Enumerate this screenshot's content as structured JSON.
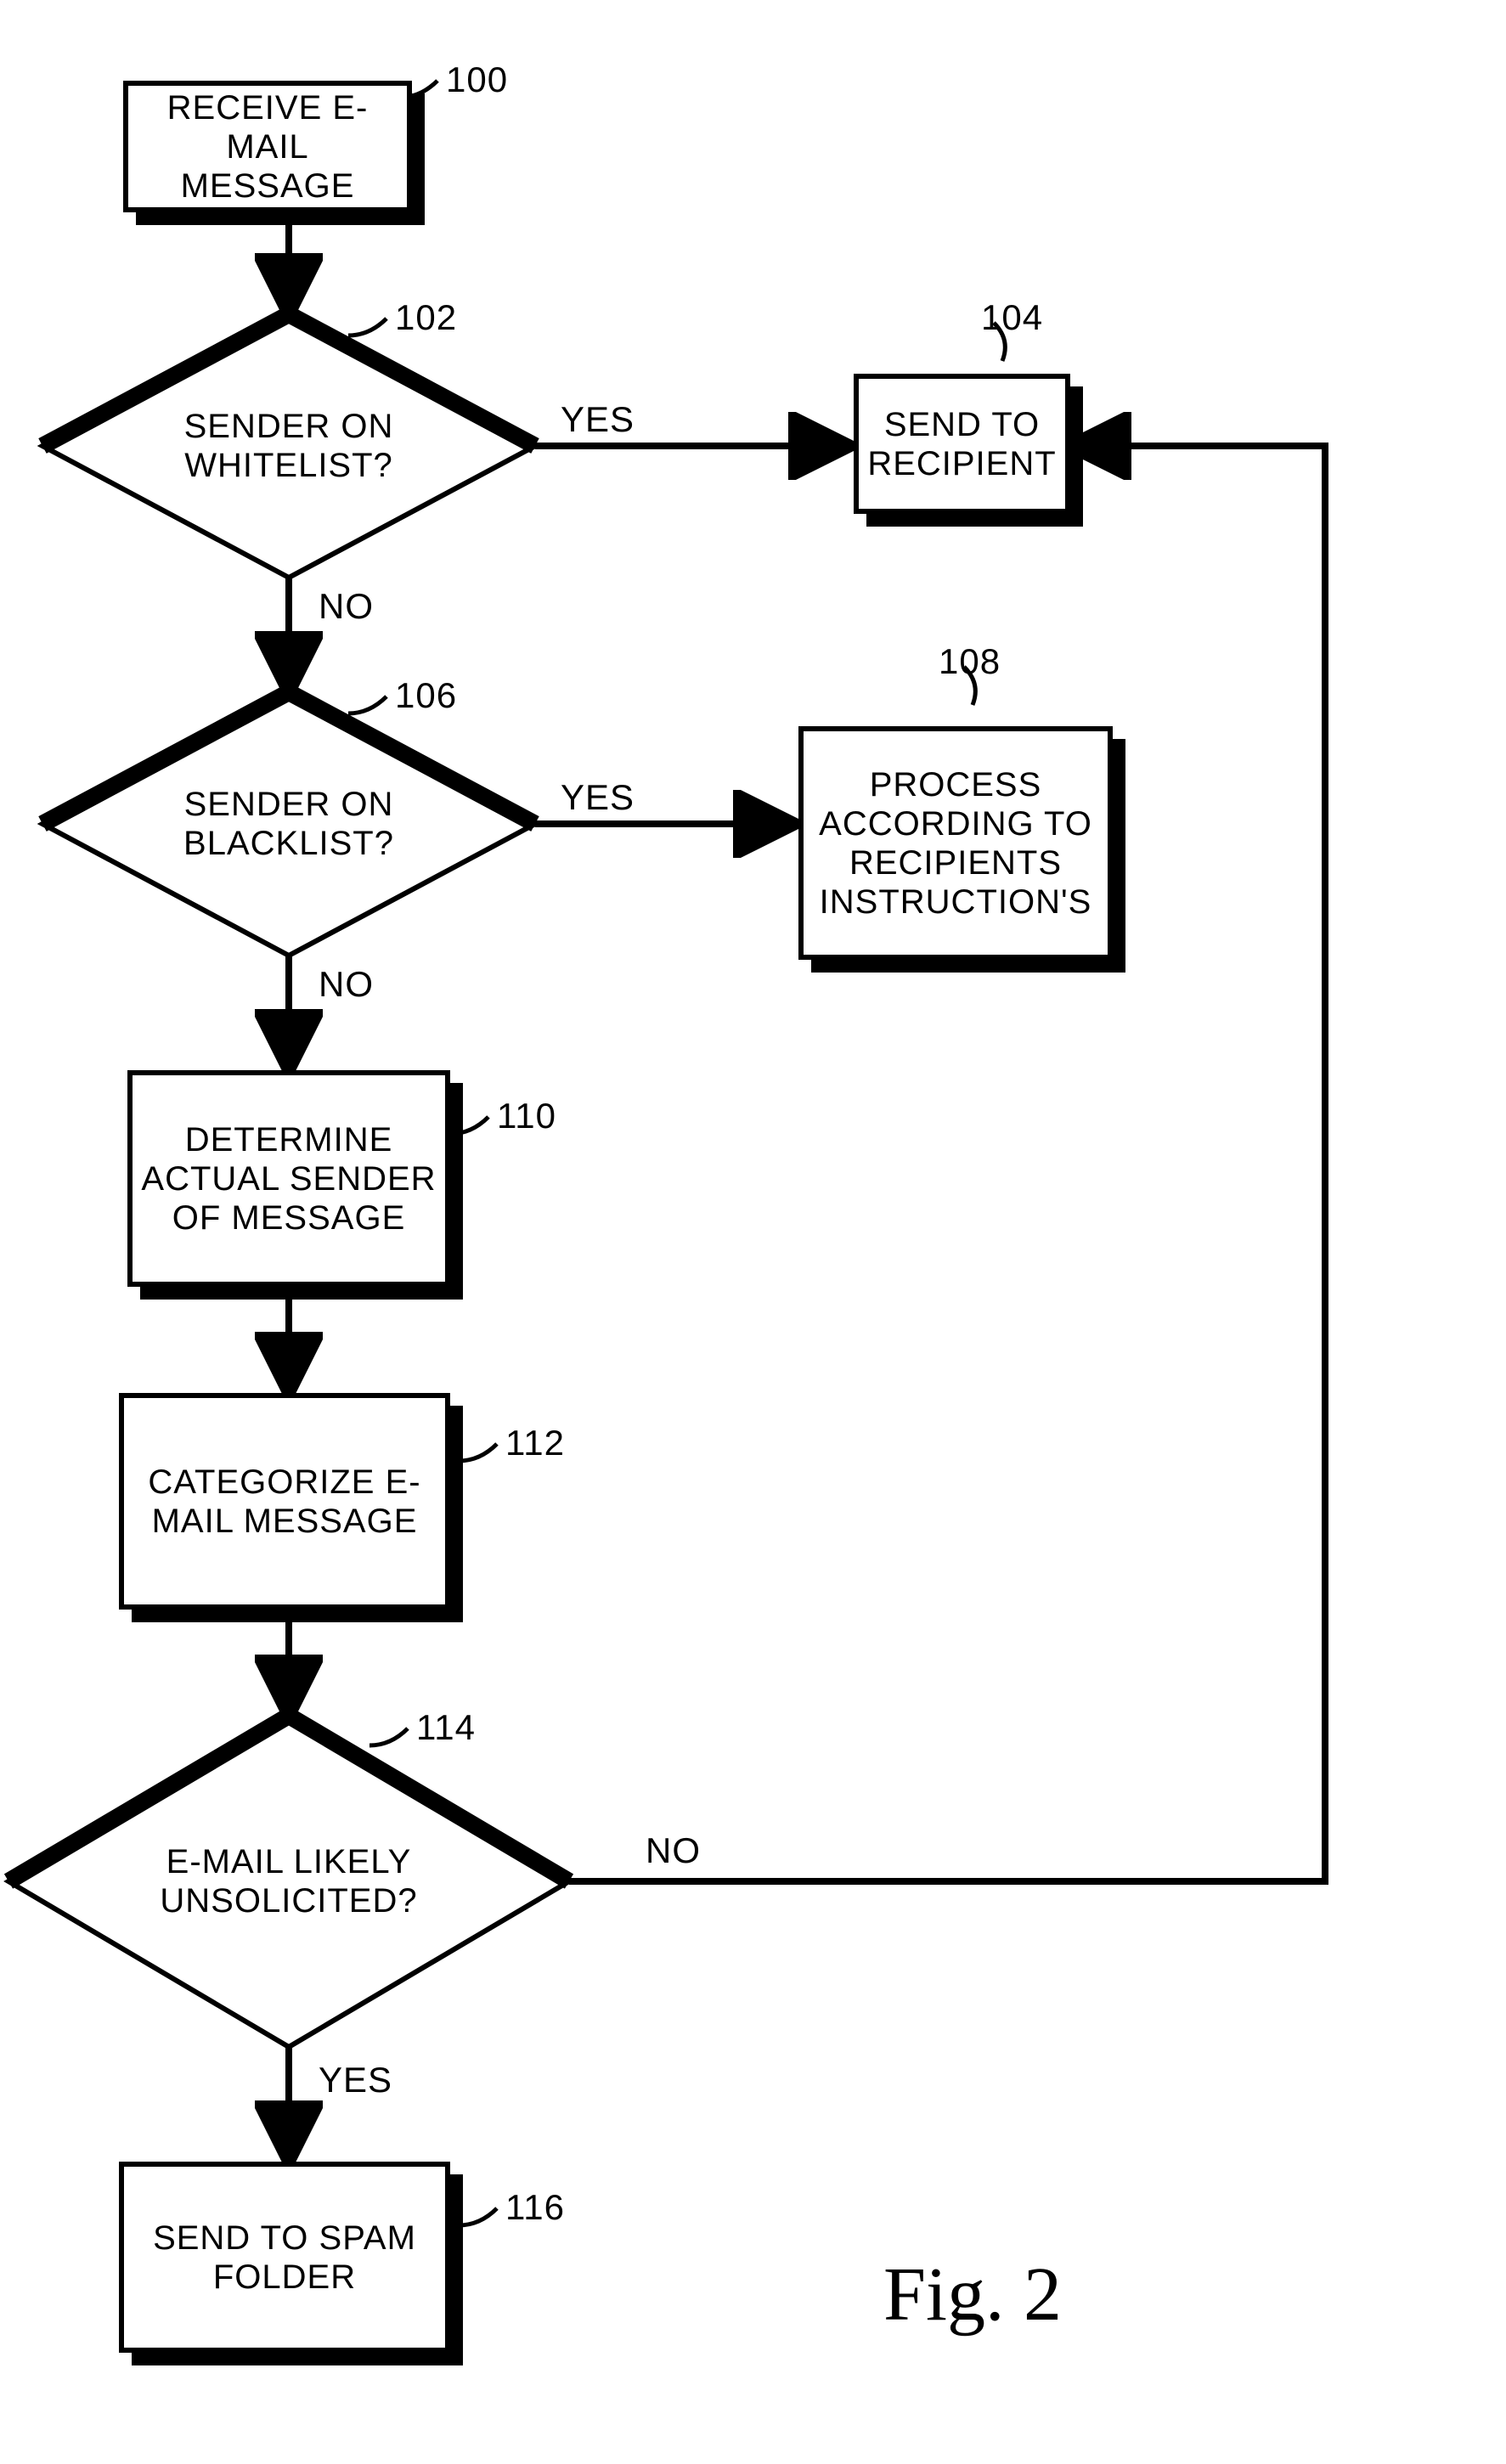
{
  "figure_label": "Fig. 2",
  "refs": {
    "n100": "100",
    "n102": "102",
    "n104": "104",
    "n106": "106",
    "n108": "108",
    "n110": "110",
    "n112": "112",
    "n114": "114",
    "n116": "116"
  },
  "edge_labels": {
    "yes_102": "YES",
    "no_102": "NO",
    "yes_106": "YES",
    "no_106": "NO",
    "no_114": "NO",
    "yes_114": "YES"
  },
  "nodes": {
    "n100": "RECEIVE E-MAIL MESSAGE",
    "n102": "SENDER ON WHITELIST?",
    "n104": "SEND TO RECIPIENT",
    "n106": "SENDER ON BLACKLIST?",
    "n108": "PROCESS ACCORDING TO RECIPIENTS INSTRUCTION'S",
    "n110": "DETERMINE ACTUAL SENDER OF MESSAGE",
    "n112": "CATEGORIZE E-MAIL MESSAGE",
    "n114": "E-MAIL LIKELY UNSOLICITED?",
    "n116": "SEND TO SPAM FOLDER"
  },
  "chart_data": {
    "type": "flowchart",
    "nodes": [
      {
        "id": "100",
        "kind": "process",
        "text": "RECEIVE E-MAIL MESSAGE"
      },
      {
        "id": "102",
        "kind": "decision",
        "text": "SENDER ON WHITELIST?"
      },
      {
        "id": "104",
        "kind": "process",
        "text": "SEND TO RECIPIENT"
      },
      {
        "id": "106",
        "kind": "decision",
        "text": "SENDER ON BLACKLIST?"
      },
      {
        "id": "108",
        "kind": "process",
        "text": "PROCESS ACCORDING TO RECIPIENTS INSTRUCTION'S"
      },
      {
        "id": "110",
        "kind": "process",
        "text": "DETERMINE ACTUAL SENDER OF MESSAGE"
      },
      {
        "id": "112",
        "kind": "process",
        "text": "CATEGORIZE E-MAIL MESSAGE"
      },
      {
        "id": "114",
        "kind": "decision",
        "text": "E-MAIL LIKELY UNSOLICITED?"
      },
      {
        "id": "116",
        "kind": "process",
        "text": "SEND TO SPAM FOLDER"
      }
    ],
    "edges": [
      {
        "from": "100",
        "to": "102",
        "label": null
      },
      {
        "from": "102",
        "to": "104",
        "label": "YES"
      },
      {
        "from": "102",
        "to": "106",
        "label": "NO"
      },
      {
        "from": "106",
        "to": "108",
        "label": "YES"
      },
      {
        "from": "106",
        "to": "110",
        "label": "NO"
      },
      {
        "from": "110",
        "to": "112",
        "label": null
      },
      {
        "from": "112",
        "to": "114",
        "label": null
      },
      {
        "from": "114",
        "to": "104",
        "label": "NO"
      },
      {
        "from": "114",
        "to": "116",
        "label": "YES"
      }
    ]
  }
}
